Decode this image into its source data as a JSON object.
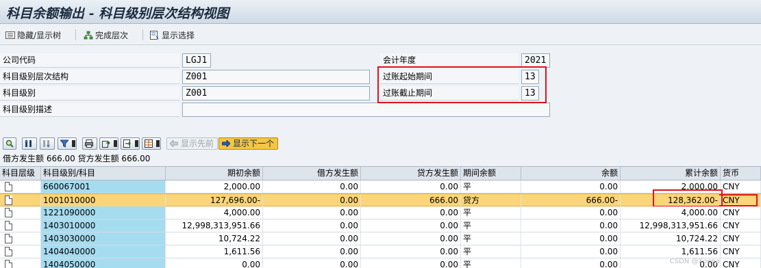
{
  "window": {
    "title": "科目余额输出 - 科目级别层次结构视图"
  },
  "toolbar": {
    "hide_show_tree": "隐藏/显示树",
    "complete_hierarchy": "完成层次",
    "show_selection": "显示选择"
  },
  "form": {
    "company_code": {
      "label": "公司代码",
      "value": "LGJ1"
    },
    "hierarchy": {
      "label": "科目级别层次结构",
      "value": "Z001"
    },
    "account_level": {
      "label": "科目级别",
      "value": "Z001"
    },
    "level_desc": {
      "label": "科目级别描述",
      "value": ""
    },
    "fiscal_year": {
      "label": "会计年度",
      "value": "2021"
    },
    "period_from": {
      "label": "过账起始期间",
      "value": "13"
    },
    "period_to": {
      "label": "过账截止期间",
      "value": "13"
    }
  },
  "alv": {
    "show_previous": "显示先前",
    "show_next": "显示下一个"
  },
  "summary": {
    "text": "借方发生额 666.00 贷方发生额 666.00"
  },
  "grid": {
    "headers": {
      "level": "科目层级",
      "account": "科目级别/科目",
      "opening": "期初余额",
      "debit": "借方发生额",
      "credit": "贷方发生额",
      "period_balance": "期间余额",
      "balance": "余额",
      "cumulative": "累计余额",
      "currency": "货币"
    },
    "rows": [
      {
        "account": "660067001",
        "opening": "2,000.00",
        "debit": "0.00",
        "credit": "0.00",
        "dc": "平",
        "balance": "0.00",
        "cumulative": "2,000.00",
        "currency": "CNY"
      },
      {
        "account": "1001010000",
        "opening": "127,696.00-",
        "debit": "0.00",
        "credit": "666.00",
        "dc": "贷方",
        "balance": "666.00-",
        "cumulative": "128,362.00-",
        "currency": "CNY"
      },
      {
        "account": "1221090000",
        "opening": "4,000.00",
        "debit": "0.00",
        "credit": "0.00",
        "dc": "平",
        "balance": "0.00",
        "cumulative": "4,000.00",
        "currency": "CNY"
      },
      {
        "account": "1403010000",
        "opening": "12,998,313,951.66",
        "debit": "0.00",
        "credit": "0.00",
        "dc": "平",
        "balance": "0.00",
        "cumulative": "12,998,313,951.66",
        "currency": "CNY"
      },
      {
        "account": "1403030000",
        "opening": "10,724.22",
        "debit": "0.00",
        "credit": "0.00",
        "dc": "平",
        "balance": "0.00",
        "cumulative": "10,724.22",
        "currency": "CNY"
      },
      {
        "account": "1404040000",
        "opening": "1,611.56",
        "debit": "0.00",
        "credit": "0.00",
        "dc": "平",
        "balance": "0.00",
        "cumulative": "1,611.56",
        "currency": "CNY"
      },
      {
        "account": "1404050000",
        "opening": "0.00",
        "debit": "0.00",
        "credit": "0.00",
        "dc": "平",
        "balance": "0.00",
        "cumulative": "0.00",
        "currency": "CNY"
      }
    ]
  },
  "watermark": "CSDN @Xoena",
  "colors": {
    "highlight_row": "#fbd57a",
    "account_cell": "#a6dcf0",
    "red_box": "#e0121a"
  }
}
